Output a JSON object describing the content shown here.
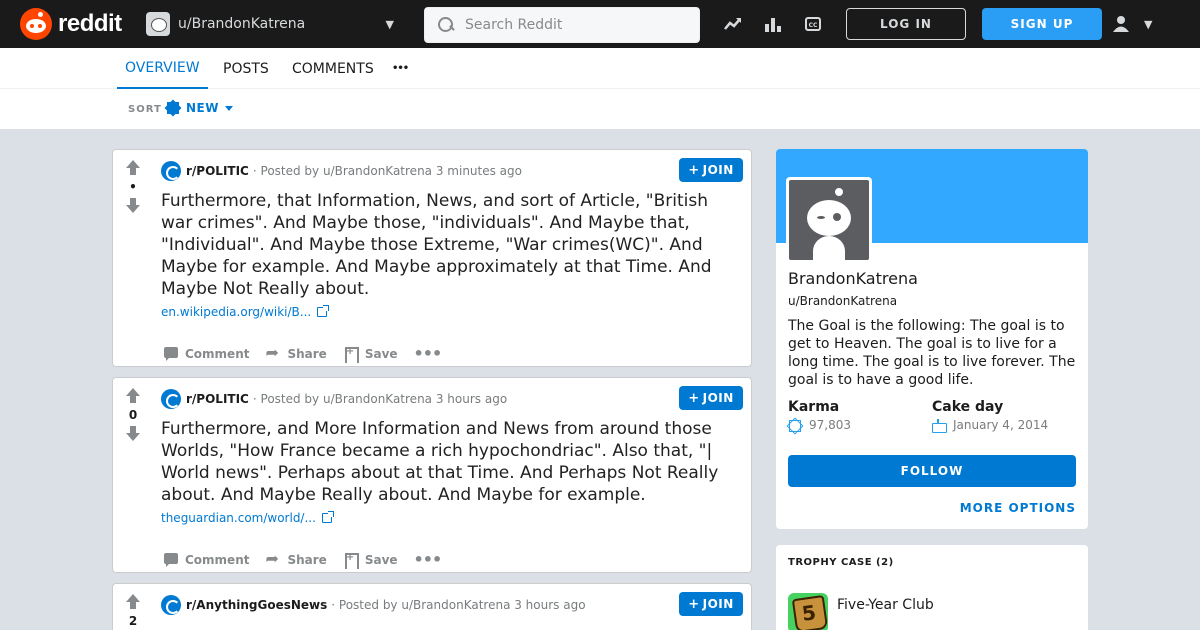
{
  "header": {
    "logo_text": "reddit",
    "user_dropdown": "u/BrandonKatrena",
    "search_placeholder": "Search Reddit",
    "login_label": "LOG IN",
    "signup_label": "SIGN UP"
  },
  "tabs": [
    "OVERVIEW",
    "POSTS",
    "COMMENTS",
    "•••"
  ],
  "sort": {
    "label": "SORT",
    "value": "NEW"
  },
  "posts": [
    {
      "score": "•",
      "subreddit": "r/POLITIC",
      "meta": "· Posted by u/BrandonKatrena 3 minutes ago",
      "join": "JOIN",
      "title": "Furthermore, that Information, News, and sort of Article, \"British war crimes\". And Maybe those, \"individuals\". And Maybe that, \"Individual\". And Maybe those Extreme, \"War crimes(WC)\". And Maybe for example. And Maybe approximately at that Time. And Maybe Not Really about.",
      "link": "en.wikipedia.org/wiki/B...",
      "comment": "Comment",
      "share": "Share",
      "save": "Save"
    },
    {
      "score": "0",
      "subreddit": "r/POLITIC",
      "meta": "· Posted by u/BrandonKatrena 3 hours ago",
      "join": "JOIN",
      "title": "Furthermore, and More Information and News from around those Worlds, \"How France became a rich hypochondriac\". Also that, \"| World news\". Perhaps about at that Time. And Perhaps Not Really about. And Maybe Really about. And Maybe for example.",
      "link": "theguardian.com/world/...",
      "comment": "Comment",
      "share": "Share",
      "save": "Save"
    },
    {
      "score": "2",
      "subreddit": "r/AnythingGoesNews",
      "meta": "· Posted by u/BrandonKatrena 3 hours ago",
      "join": "JOIN"
    }
  ],
  "profile": {
    "display_name": "BrandonKatrena",
    "handle": "u/BrandonKatrena",
    "bio": "The Goal is the following: The goal is to get to Heaven. The goal is to live for a long time. The goal is to live forever. The goal is to have a good life.",
    "karma_label": "Karma",
    "karma_value": "97,803",
    "cakeday_label": "Cake day",
    "cakeday_value": "January 4, 2014",
    "follow_label": "FOLLOW",
    "more_options": "MORE OPTIONS"
  },
  "trophy_case": {
    "title": "TROPHY CASE (2)",
    "items": [
      {
        "name": "Five-Year Club",
        "badge": "5"
      }
    ]
  },
  "colors": {
    "header_bg": "#1a1a1b",
    "brand": "#ff4500",
    "accent": "#0079d3",
    "signup": "#2a9df4",
    "banner": "#33a8ff",
    "page_bg": "#dae0e6"
  }
}
